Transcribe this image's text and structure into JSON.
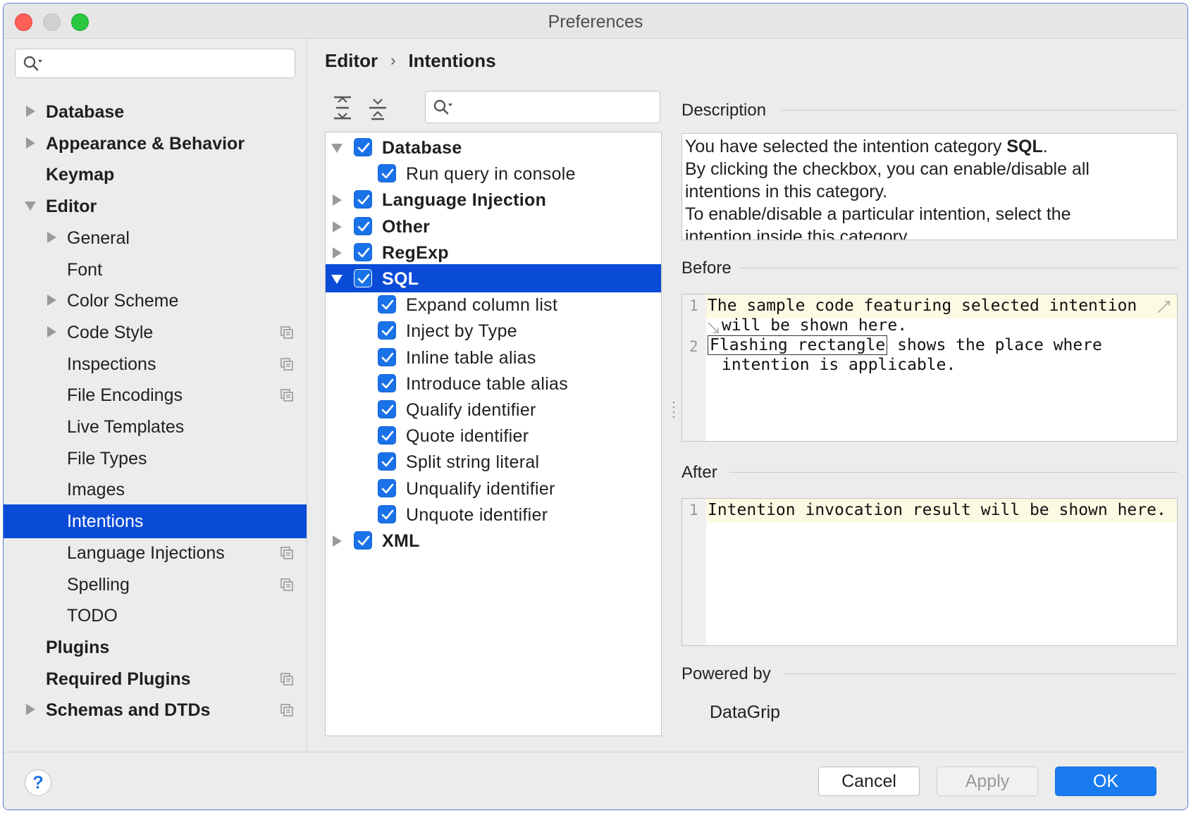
{
  "window": {
    "title": "Preferences"
  },
  "sidebar": {
    "search_placeholder": "",
    "items": [
      {
        "label": "Database",
        "bold": true,
        "arrow": "right",
        "level": 0
      },
      {
        "label": "Appearance & Behavior",
        "bold": true,
        "arrow": "right",
        "level": 0
      },
      {
        "label": "Keymap",
        "bold": true,
        "arrow": "none",
        "level": 0
      },
      {
        "label": "Editor",
        "bold": true,
        "arrow": "down",
        "level": 0
      },
      {
        "label": "General",
        "bold": false,
        "arrow": "right",
        "level": 1
      },
      {
        "label": "Font",
        "bold": false,
        "arrow": "none",
        "level": 1
      },
      {
        "label": "Color Scheme",
        "bold": false,
        "arrow": "right",
        "level": 1
      },
      {
        "label": "Code Style",
        "bold": false,
        "arrow": "right",
        "level": 1,
        "project_icon": true
      },
      {
        "label": "Inspections",
        "bold": false,
        "arrow": "none",
        "level": 1,
        "project_icon": true
      },
      {
        "label": "File Encodings",
        "bold": false,
        "arrow": "none",
        "level": 1,
        "project_icon": true
      },
      {
        "label": "Live Templates",
        "bold": false,
        "arrow": "none",
        "level": 1
      },
      {
        "label": "File Types",
        "bold": false,
        "arrow": "none",
        "level": 1
      },
      {
        "label": "Images",
        "bold": false,
        "arrow": "none",
        "level": 1
      },
      {
        "label": "Intentions",
        "bold": false,
        "arrow": "none",
        "level": 1,
        "selected": true
      },
      {
        "label": "Language Injections",
        "bold": false,
        "arrow": "none",
        "level": 1,
        "project_icon": true
      },
      {
        "label": "Spelling",
        "bold": false,
        "arrow": "none",
        "level": 1,
        "project_icon": true
      },
      {
        "label": "TODO",
        "bold": false,
        "arrow": "none",
        "level": 1
      },
      {
        "label": "Plugins",
        "bold": true,
        "arrow": "none",
        "level": 0
      },
      {
        "label": "Required Plugins",
        "bold": true,
        "arrow": "none",
        "level": 0,
        "project_icon": true
      },
      {
        "label": "Schemas and DTDs",
        "bold": true,
        "arrow": "right",
        "level": 0,
        "project_icon": true
      }
    ]
  },
  "breadcrumb": {
    "parent": "Editor",
    "separator": "›",
    "current": "Intentions"
  },
  "toolbar": {
    "expand_all_icon": "expand-all-icon",
    "collapse_all_icon": "collapse-all-icon",
    "search_placeholder": ""
  },
  "intentions": [
    {
      "label": "Database",
      "bold": true,
      "arrow": "down",
      "level": 0,
      "checked": true
    },
    {
      "label": "Run query in console",
      "bold": false,
      "arrow": "none",
      "level": 1,
      "checked": true
    },
    {
      "label": "Language Injection",
      "bold": true,
      "arrow": "right",
      "level": 0,
      "checked": true
    },
    {
      "label": "Other",
      "bold": true,
      "arrow": "right",
      "level": 0,
      "checked": true
    },
    {
      "label": "RegExp",
      "bold": true,
      "arrow": "right",
      "level": 0,
      "checked": true
    },
    {
      "label": "SQL",
      "bold": true,
      "arrow": "down",
      "level": 0,
      "checked": true,
      "selected": true
    },
    {
      "label": "Expand column list",
      "bold": false,
      "arrow": "none",
      "level": 1,
      "checked": true
    },
    {
      "label": "Inject by Type",
      "bold": false,
      "arrow": "none",
      "level": 1,
      "checked": true
    },
    {
      "label": "Inline table alias",
      "bold": false,
      "arrow": "none",
      "level": 1,
      "checked": true
    },
    {
      "label": "Introduce table alias",
      "bold": false,
      "arrow": "none",
      "level": 1,
      "checked": true
    },
    {
      "label": "Qualify identifier",
      "bold": false,
      "arrow": "none",
      "level": 1,
      "checked": true
    },
    {
      "label": "Quote identifier",
      "bold": false,
      "arrow": "none",
      "level": 1,
      "checked": true
    },
    {
      "label": "Split string literal",
      "bold": false,
      "arrow": "none",
      "level": 1,
      "checked": true
    },
    {
      "label": "Unqualify identifier",
      "bold": false,
      "arrow": "none",
      "level": 1,
      "checked": true
    },
    {
      "label": "Unquote identifier",
      "bold": false,
      "arrow": "none",
      "level": 1,
      "checked": true
    },
    {
      "label": "XML",
      "bold": true,
      "arrow": "right",
      "level": 0,
      "checked": true
    }
  ],
  "description": {
    "title": "Description",
    "line1_prefix": "You have selected the intention category ",
    "line1_bold": "SQL",
    "line1_suffix": ".",
    "line2": "By clicking the checkbox, you can enable/disable all",
    "line3": "intentions in this category.",
    "line4": "To enable/disable a particular intention, select the",
    "line5": "intention inside this category."
  },
  "before": {
    "title": "Before",
    "line1_num": "1",
    "line1_text": "The sample code featuring selected intention",
    "line1_wrap": "will be shown here.",
    "line2_num": "2",
    "line2_flash": "Flashing rectangle",
    "line2_rest": " shows the place where",
    "line2_wrap": "intention is applicable."
  },
  "after": {
    "title": "After",
    "line1_num": "1",
    "line1_text": "Intention invocation result will be shown here."
  },
  "powered_by": {
    "title": "Powered by",
    "value": "DataGrip"
  },
  "buttons": {
    "help": "?",
    "cancel": "Cancel",
    "apply": "Apply",
    "ok": "OK"
  },
  "colors": {
    "selection": "#0a4bd8",
    "checkbox": "#1a72e8",
    "ok_button": "#1a7bf0",
    "current_line": "#fdfae3"
  }
}
